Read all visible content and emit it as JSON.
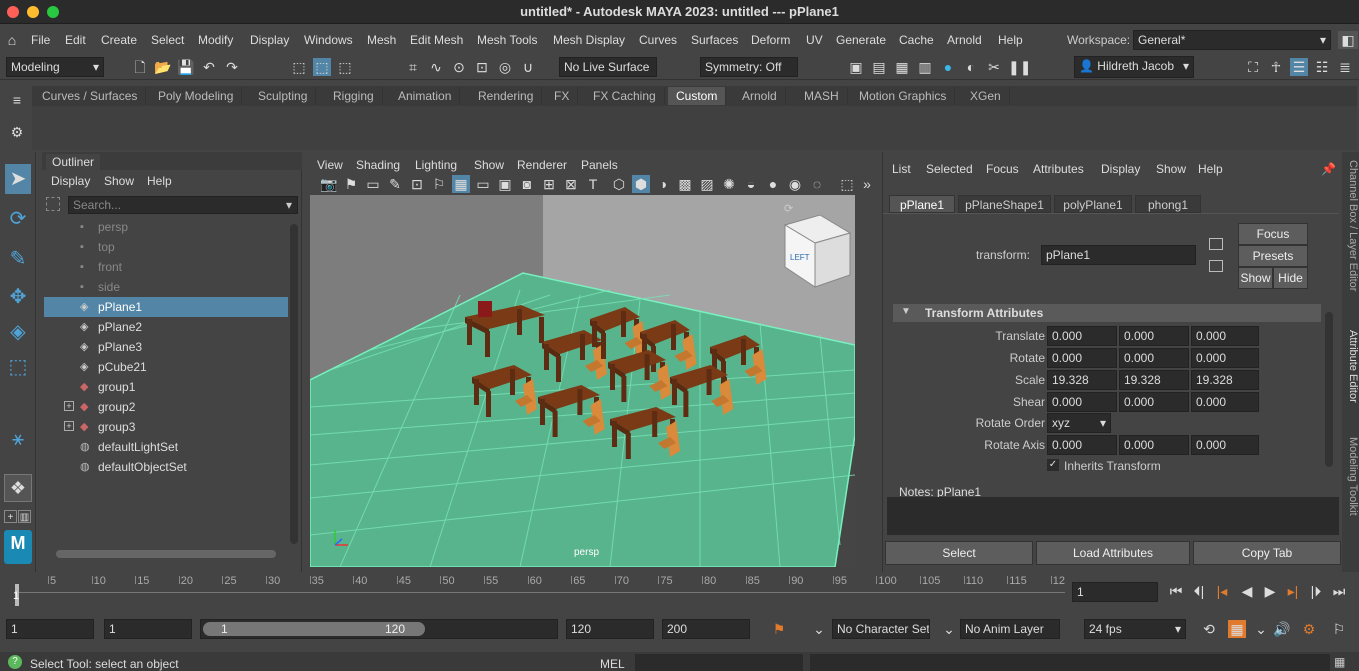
{
  "window": {
    "title": "untitled* - Autodesk MAYA 2023: untitled   ---   pPlane1"
  },
  "menubar": {
    "items": [
      "File",
      "Edit",
      "Create",
      "Select",
      "Modify",
      "Display",
      "Windows",
      "Mesh",
      "Edit Mesh",
      "Mesh Tools",
      "Mesh Display",
      "Curves",
      "Surfaces",
      "Deform",
      "UV",
      "Generate",
      "Cache",
      "Arnold",
      "Help"
    ],
    "workspace_label": "Workspace:",
    "workspace_value": "General*"
  },
  "statusline": {
    "mode": "Modeling",
    "live_surface": "No Live Surface",
    "symmetry": "Symmetry: Off",
    "user": "Hildreth Jacob"
  },
  "shelf": {
    "tabs": [
      "Curves / Surfaces",
      "Poly Modeling",
      "Sculpting",
      "Rigging",
      "Animation",
      "Rendering",
      "FX",
      "FX Caching",
      "Custom",
      "Arnold",
      "MASH",
      "Motion Graphics",
      "XGen"
    ],
    "active": "Custom"
  },
  "outliner": {
    "title": "Outliner",
    "menu": [
      "Display",
      "Show",
      "Help"
    ],
    "search_placeholder": "Search...",
    "items": [
      {
        "label": "persp"
      },
      {
        "label": "top"
      },
      {
        "label": "front"
      },
      {
        "label": "side"
      },
      {
        "label": "pPlane1"
      },
      {
        "label": "pPlane2"
      },
      {
        "label": "pPlane3"
      },
      {
        "label": "pCube21"
      },
      {
        "label": "group1"
      },
      {
        "label": "group2"
      },
      {
        "label": "group3"
      },
      {
        "label": "defaultLightSet"
      },
      {
        "label": "defaultObjectSet"
      }
    ]
  },
  "viewport": {
    "menu": [
      "View",
      "Shading",
      "Lighting",
      "Show",
      "Renderer",
      "Panels"
    ],
    "camera_label": "persp",
    "viewcube_label": "LEFT"
  },
  "attr_editor": {
    "menu": [
      "List",
      "Selected",
      "Focus",
      "Attributes",
      "Display",
      "Show",
      "Help"
    ],
    "tabs": [
      "pPlane1",
      "pPlaneShape1",
      "polyPlane1",
      "phong1"
    ],
    "transform_label": "transform:",
    "transform_value": "pPlane1",
    "buttons": {
      "focus": "Focus",
      "presets": "Presets",
      "show": "Show",
      "hide": "Hide"
    },
    "section": "Transform Attributes",
    "rows": [
      {
        "label": "Translate",
        "values": [
          "0.000",
          "0.000",
          "0.000"
        ]
      },
      {
        "label": "Rotate",
        "values": [
          "0.000",
          "0.000",
          "0.000"
        ]
      },
      {
        "label": "Scale",
        "values": [
          "19.328",
          "19.328",
          "19.328"
        ]
      },
      {
        "label": "Shear",
        "values": [
          "0.000",
          "0.000",
          "0.000"
        ]
      }
    ],
    "rotate_order_label": "Rotate Order",
    "rotate_order": "xyz",
    "rotate_axis_label": "Rotate Axis",
    "rotate_axis": [
      "0.000",
      "0.000",
      "0.000"
    ],
    "inherits": "Inherits Transform",
    "notes": "Notes:  pPlane1",
    "bottom_buttons": [
      "Select",
      "Load Attributes",
      "Copy Tab"
    ]
  },
  "side_tabs": [
    "Channel Box / Layer Editor",
    "Attribute Editor",
    "Modeling Toolkit"
  ],
  "timeline": {
    "ticks": [
      "5",
      "10",
      "15",
      "20",
      "25",
      "30",
      "35",
      "40",
      "45",
      "50",
      "55",
      "60",
      "65",
      "70",
      "75",
      "80",
      "85",
      "90",
      "95",
      "100",
      "105",
      "110",
      "115",
      "12"
    ],
    "start_marker": "1",
    "current_frame": "1"
  },
  "range": {
    "start": "1",
    "playback_start": "1",
    "slider_start": "1",
    "slider_end": "120",
    "playback_end": "120",
    "end": "200",
    "character_set": "No Character Set",
    "anim_layer": "No Anim Layer",
    "fps": "24 fps"
  },
  "helpline": {
    "text": "Select Tool: select an object",
    "mel": "MEL"
  },
  "colors": {
    "grid": "#6fd3a8",
    "accent": "#5285a6"
  }
}
